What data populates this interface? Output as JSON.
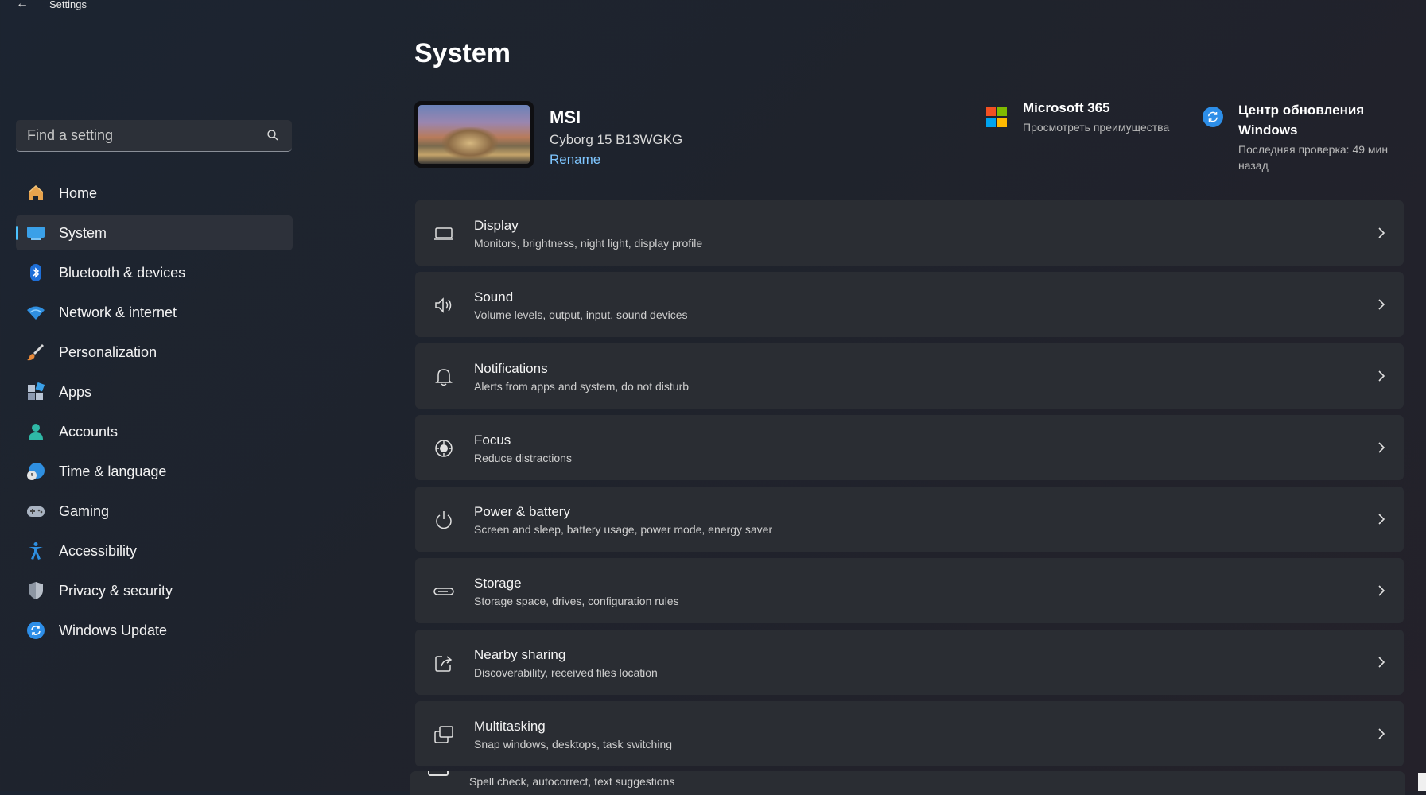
{
  "window": {
    "title": "Settings",
    "back_icon": "back-arrow-icon"
  },
  "search": {
    "placeholder": "Find a setting",
    "value": ""
  },
  "sidebar": {
    "items": [
      {
        "label": "Home",
        "icon": "home-icon",
        "active": false
      },
      {
        "label": "System",
        "icon": "system-icon",
        "active": true
      },
      {
        "label": "Bluetooth & devices",
        "icon": "bluetooth-icon",
        "active": false
      },
      {
        "label": "Network & internet",
        "icon": "wifi-icon",
        "active": false
      },
      {
        "label": "Personalization",
        "icon": "brush-icon",
        "active": false
      },
      {
        "label": "Apps",
        "icon": "apps-icon",
        "active": false
      },
      {
        "label": "Accounts",
        "icon": "accounts-icon",
        "active": false
      },
      {
        "label": "Time & language",
        "icon": "time-language-icon",
        "active": false
      },
      {
        "label": "Gaming",
        "icon": "gamepad-icon",
        "active": false
      },
      {
        "label": "Accessibility",
        "icon": "accessibility-icon",
        "active": false
      },
      {
        "label": "Privacy & security",
        "icon": "shield-icon",
        "active": false
      },
      {
        "label": "Windows Update",
        "icon": "windows-update-icon",
        "active": false
      }
    ]
  },
  "main": {
    "title": "System",
    "device": {
      "name": "MSI",
      "model": "Cyborg 15 B13WGKG",
      "rename": "Rename"
    },
    "microsoft365": {
      "title": "Microsoft 365",
      "subtitle": "Просмотреть преимущества"
    },
    "windows_update": {
      "title": "Центр обновления Windows",
      "subtitle": "Последняя проверка: 49 мин назад"
    },
    "cards": [
      {
        "title": "Display",
        "subtitle": "Monitors, brightness, night light, display profile",
        "icon": "display-icon"
      },
      {
        "title": "Sound",
        "subtitle": "Volume levels, output, input, sound devices",
        "icon": "speaker-icon"
      },
      {
        "title": "Notifications",
        "subtitle": "Alerts from apps and system, do not disturb",
        "icon": "bell-icon"
      },
      {
        "title": "Focus",
        "subtitle": "Reduce distractions",
        "icon": "focus-icon"
      },
      {
        "title": "Power & battery",
        "subtitle": "Screen and sleep, battery usage, power mode, energy saver",
        "icon": "power-icon"
      },
      {
        "title": "Storage",
        "subtitle": "Storage space, drives, configuration rules",
        "icon": "storage-icon"
      },
      {
        "title": "Nearby sharing",
        "subtitle": "Discoverability, received files location",
        "icon": "share-icon"
      },
      {
        "title": "Multitasking",
        "subtitle": "Snap windows, desktops, task switching",
        "icon": "multitasking-icon"
      }
    ],
    "partial_card": {
      "subtitle": "Spell check, autocorrect, text suggestions",
      "icon": "keyboard-icon"
    }
  },
  "colors": {
    "accent": "#4cc2ff",
    "card_bg": "#2a2d33",
    "link": "#7fc6ff"
  }
}
